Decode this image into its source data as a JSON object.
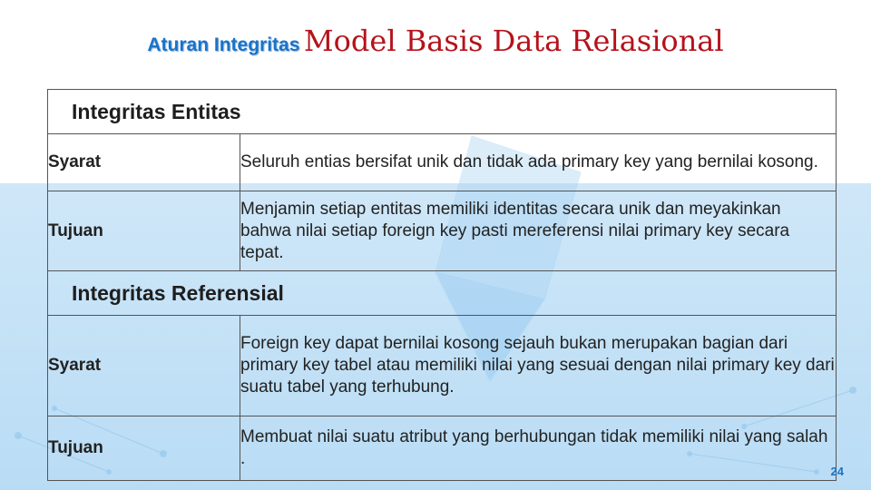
{
  "slide": {
    "title_prefix": "Aturan Integritas",
    "title_main": "Model Basis Data Relasional",
    "page_number": "24"
  },
  "sections": [
    {
      "title": "Integritas Entitas",
      "rows": [
        {
          "label": "Syarat",
          "text": "Seluruh entias bersifat unik dan tidak ada primary key yang bernilai kosong."
        },
        {
          "label": "Tujuan",
          "text": "Menjamin setiap entitas memiliki identitas secara unik dan meyakinkan bahwa nilai setiap foreign key pasti mereferensi nilai primary key secara tepat."
        }
      ]
    },
    {
      "title": "Integritas Referensial",
      "rows": [
        {
          "label": "Syarat",
          "text": "Foreign key dapat bernilai kosong sejauh bukan merupakan bagian dari primary key tabel atau memiliki nilai yang sesuai dengan nilai primary key dari suatu tabel yang terhubung."
        },
        {
          "label": "Tujuan",
          "text": "Membuat nilai suatu atribut yang berhubungan tidak memiliki nilai yang salah ."
        }
      ]
    }
  ],
  "colors": {
    "title_prefix": "#1a73c9",
    "title_main": "#b5121b",
    "label": "#d0121b",
    "background_band": "#c2e1f7"
  }
}
